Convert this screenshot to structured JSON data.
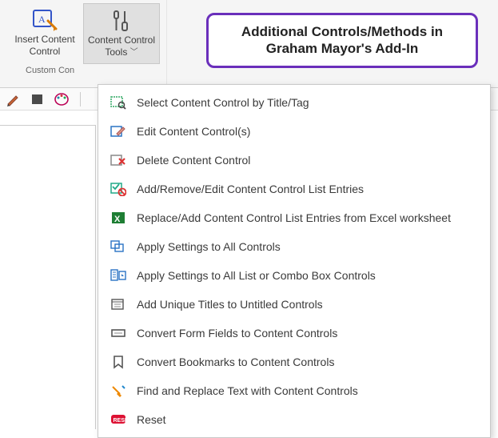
{
  "ribbon": {
    "buttons": [
      {
        "label": "Insert Content Control",
        "name": "insert-content-control-button"
      },
      {
        "label": "Content Control Tools",
        "name": "content-control-tools-button"
      }
    ],
    "group_label": "Custom Con"
  },
  "callout": {
    "text": "Additional Controls/Methods in Graham Mayor's Add-In"
  },
  "menu": {
    "items": [
      {
        "label": "Select Content Control by Title/Tag",
        "icon": "select-cc-icon"
      },
      {
        "label": "Edit Content Control(s)",
        "icon": "edit-cc-icon"
      },
      {
        "label": "Delete Content Control",
        "icon": "delete-cc-icon"
      },
      {
        "label": "Add/Remove/Edit Content Control List Entries",
        "icon": "list-entries-icon"
      },
      {
        "label": "Replace/Add Content Control List Entries from Excel worksheet",
        "icon": "excel-icon"
      },
      {
        "label": "Apply Settings to All Controls",
        "icon": "apply-all-icon"
      },
      {
        "label": "Apply Settings to All List or Combo Box Controls",
        "icon": "apply-list-icon"
      },
      {
        "label": "Add Unique Titles to Untitled Controls",
        "icon": "unique-titles-icon"
      },
      {
        "label": "Convert Form Fields to Content Controls",
        "icon": "convert-form-icon"
      },
      {
        "label": "Convert Bookmarks to Content Controls",
        "icon": "convert-bookmark-icon"
      },
      {
        "label": "Find and Replace Text with Content Controls",
        "icon": "find-replace-icon"
      },
      {
        "label": "Reset",
        "icon": "reset-icon"
      }
    ]
  }
}
